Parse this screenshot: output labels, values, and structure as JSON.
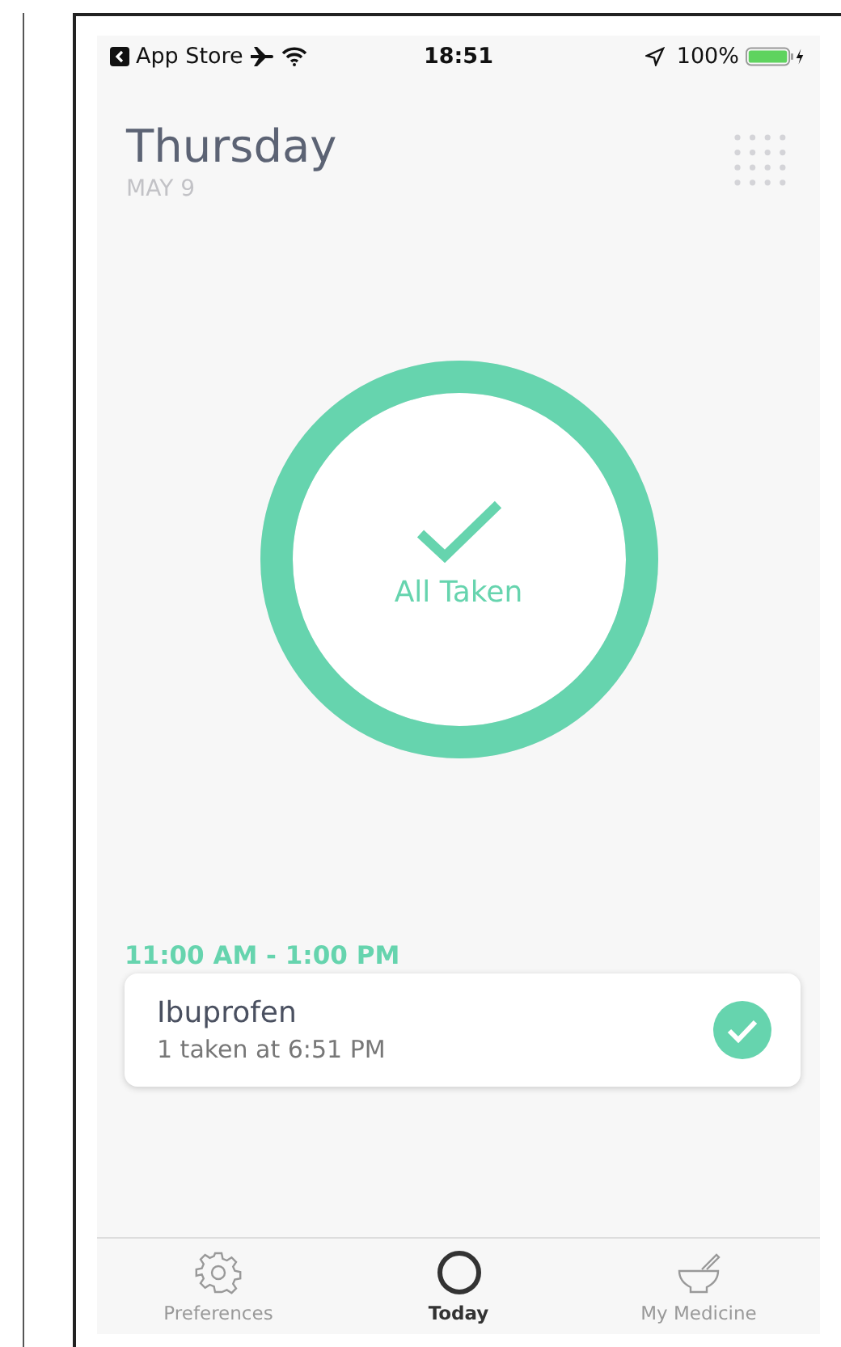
{
  "status_bar": {
    "back_app": "App Store",
    "time": "18:51",
    "battery": "100%"
  },
  "header": {
    "day": "Thursday",
    "date": "MAY 9"
  },
  "progress": {
    "level": 1,
    "label": "All Taken"
  },
  "schedule": [
    {
      "time_range": "11:00 AM - 1:00 PM",
      "doses": [
        {
          "name": "Ibuprofen",
          "detail": "1 taken at 6:51 PM",
          "taken": true
        }
      ]
    }
  ],
  "tabs": [
    {
      "label": "Preferences",
      "kind": "gear",
      "selected": false
    },
    {
      "label": "Today",
      "kind": "ring",
      "selected": true
    },
    {
      "label": "My Medicine",
      "kind": "mortar",
      "selected": false
    }
  ]
}
